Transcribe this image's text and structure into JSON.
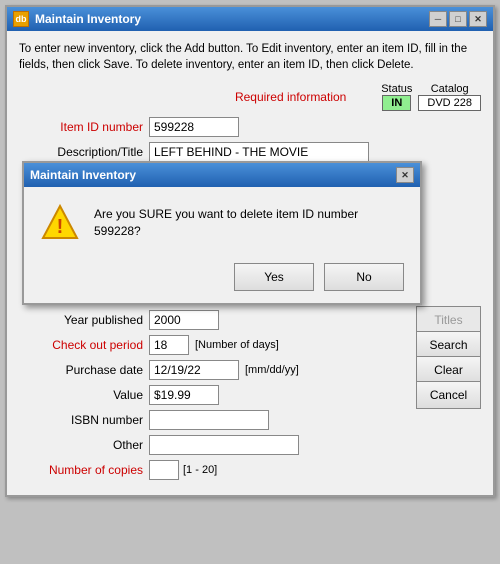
{
  "window": {
    "title": "Maintain Inventory",
    "icon": "db",
    "buttons": {
      "minimize": "─",
      "maximize": "□",
      "close": "✕"
    }
  },
  "instructions": "To enter new inventory, click the Add button.  To Edit inventory, enter an item ID, fill in the fields, then click Save.  To delete inventory, enter an item ID, then click Delete.",
  "required_label": "Required information",
  "status": {
    "label": "Status",
    "value": "IN"
  },
  "catalog": {
    "label": "Catalog",
    "value": "DVD 228"
  },
  "fields": {
    "item_id": {
      "label": "Item ID number",
      "value": "599228"
    },
    "description": {
      "label": "Description/Title",
      "value": "LEFT BEHIND - THE MOVIE"
    },
    "year": {
      "label": "Year published",
      "value": "2000"
    },
    "checkout": {
      "label": "Check out period",
      "value": "18",
      "hint": "[Number of days]"
    },
    "purchase_date": {
      "label": "Purchase date",
      "value": "12/19/22",
      "hint": "[mm/dd/yy]"
    },
    "value": {
      "label": "Value",
      "value": "$19.99"
    },
    "isbn": {
      "label": "ISBN number",
      "value": ""
    },
    "other": {
      "label": "Other",
      "value": ""
    },
    "copies": {
      "label": "Number of copies",
      "value": "",
      "hint": "[1 - 20]"
    }
  },
  "buttons": {
    "titles": "Titles",
    "search": "Search",
    "clear": "Clear",
    "cancel": "Cancel"
  },
  "modal": {
    "title": "Maintain Inventory",
    "close": "✕",
    "message": "Are you SURE you want to delete item ID number 599228?",
    "yes": "Yes",
    "no": "No"
  }
}
